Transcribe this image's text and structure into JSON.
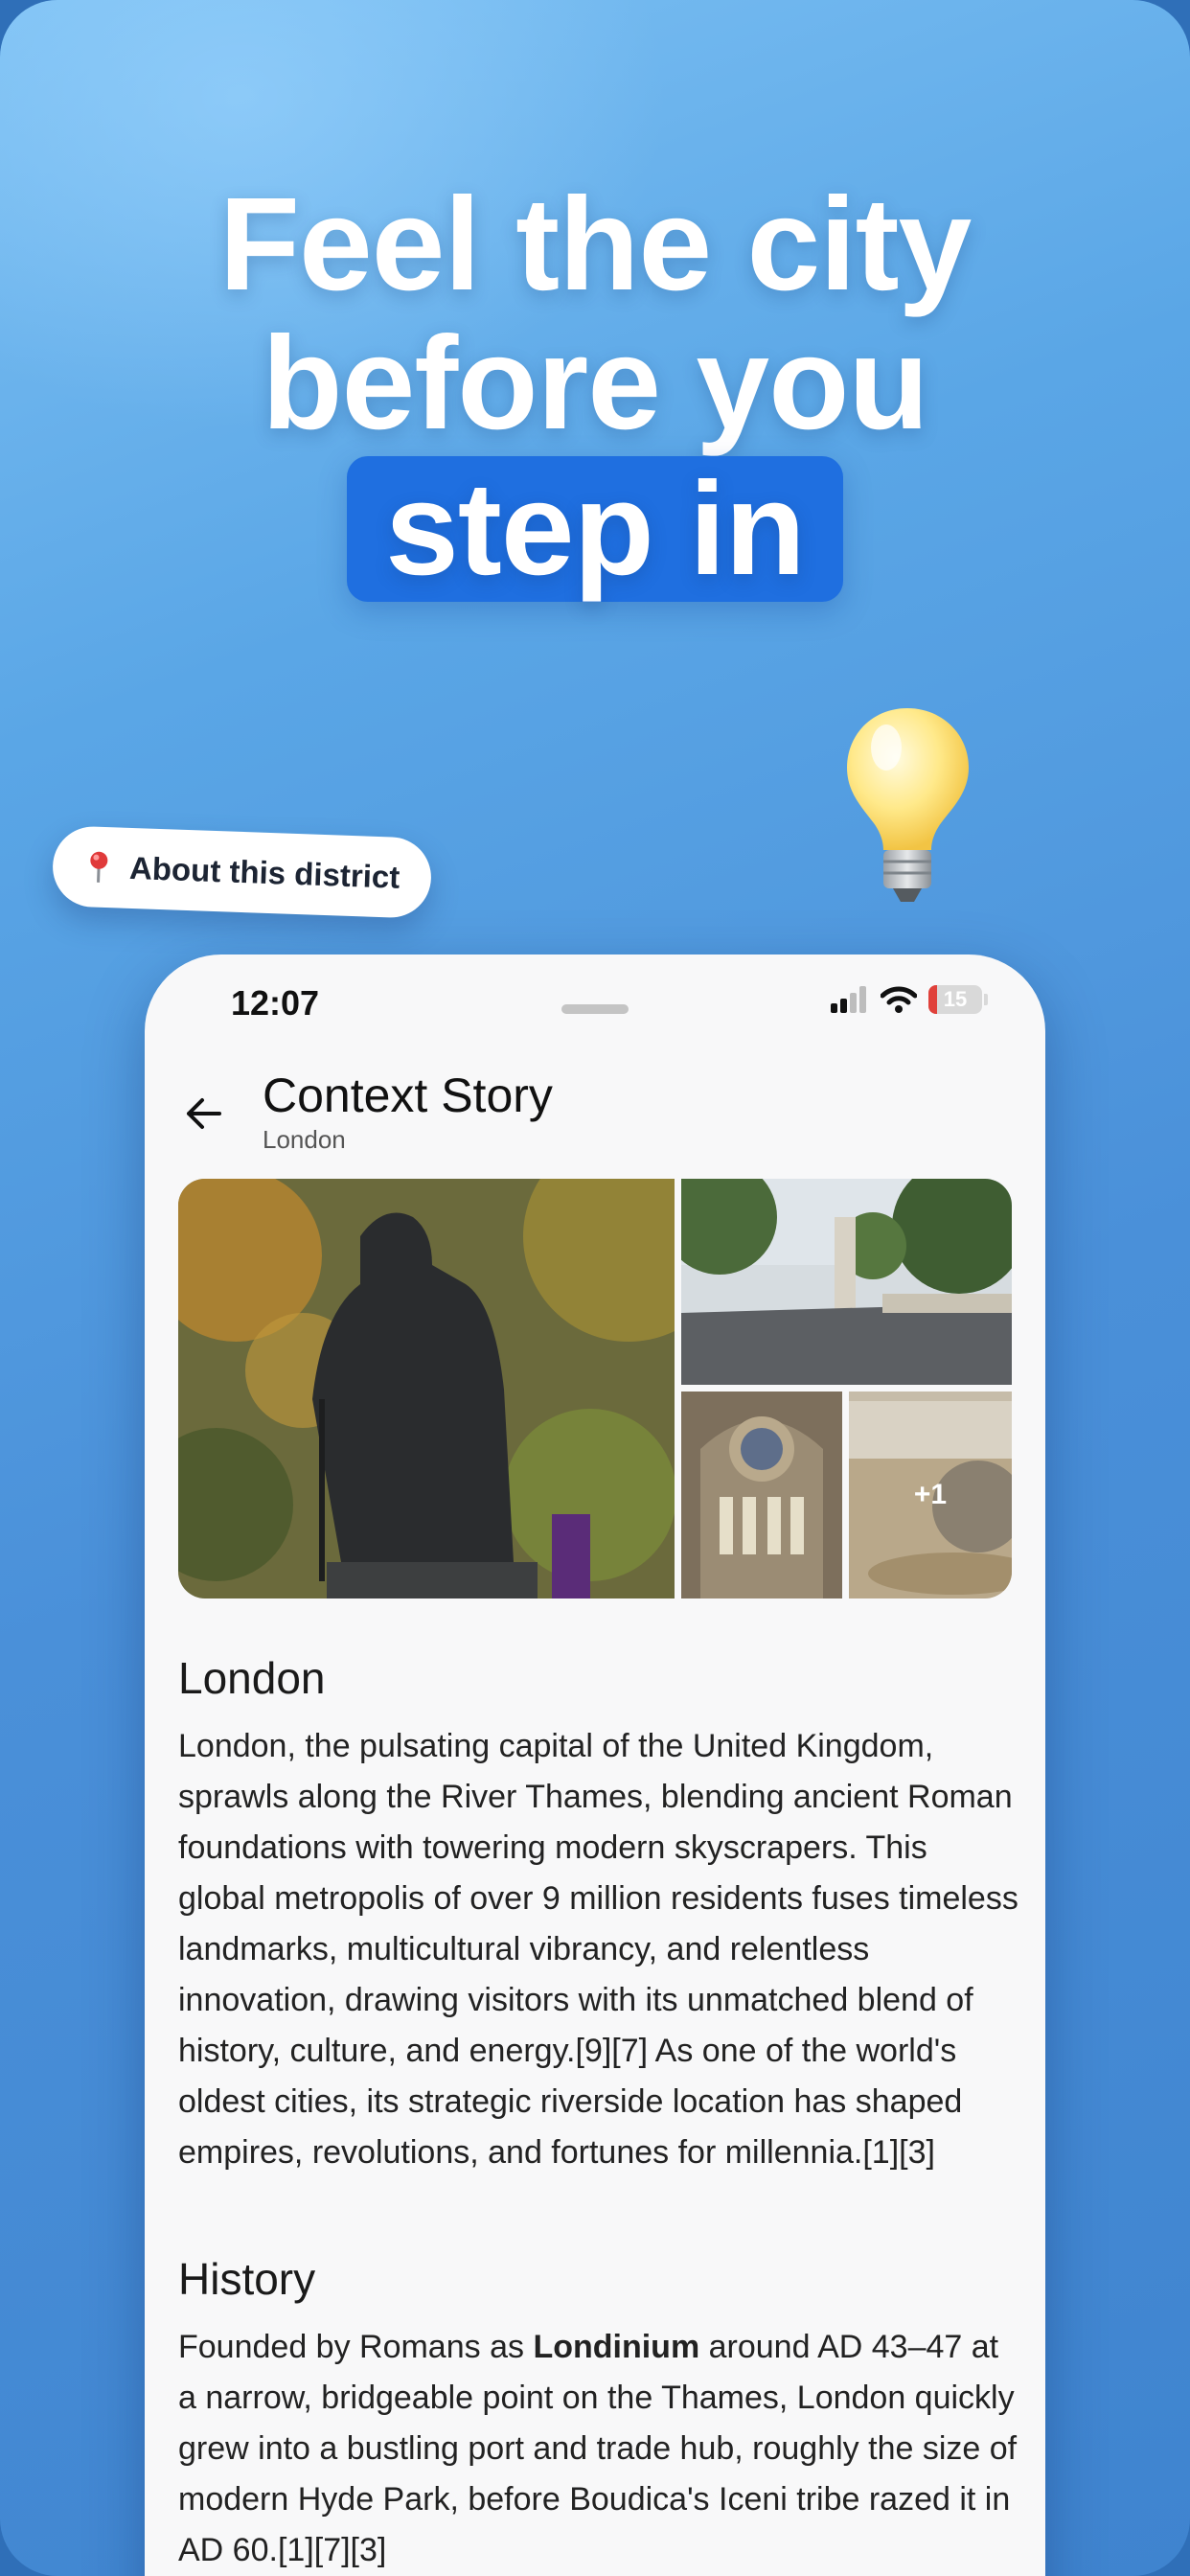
{
  "headline": {
    "line1": "Feel the city",
    "line2": "before you",
    "line3": "step in"
  },
  "pill": {
    "label": "About this district",
    "icon": "pin-icon"
  },
  "status_bar": {
    "time": "12:07",
    "battery": "15"
  },
  "header": {
    "title": "Context Story",
    "subtitle": "London"
  },
  "gallery": {
    "more_count": "+1"
  },
  "sections": {
    "intro_title": "London",
    "intro_text": "London, the pulsating capital of the United Kingdom, sprawls along the River Thames, blending ancient Roman foundations with towering modern skyscrapers. This global metropolis of over 9 million residents fuses timeless landmarks, multicultural vibrancy, and relentless innovation, drawing visitors with its unmatched blend of history, culture, and energy.[9][7] As one of the world's oldest cities, its strategic riverside location has shaped empires, revolutions, and fortunes for millennia.[1][3]",
    "history_title": "History",
    "history_pre": "Founded by Romans as ",
    "history_bold": "Londinium",
    "history_post": " around AD 43–47 at a narrow, bridgeable point on the Thames, London quickly grew into a bustling port and trade hub, roughly the size of modern Hyde Park, before Boudica's Iceni tribe razed it in AD 60.[1][7][3]"
  },
  "colors": {
    "accent": "#1f6fe0",
    "background": "#4a90d9"
  }
}
